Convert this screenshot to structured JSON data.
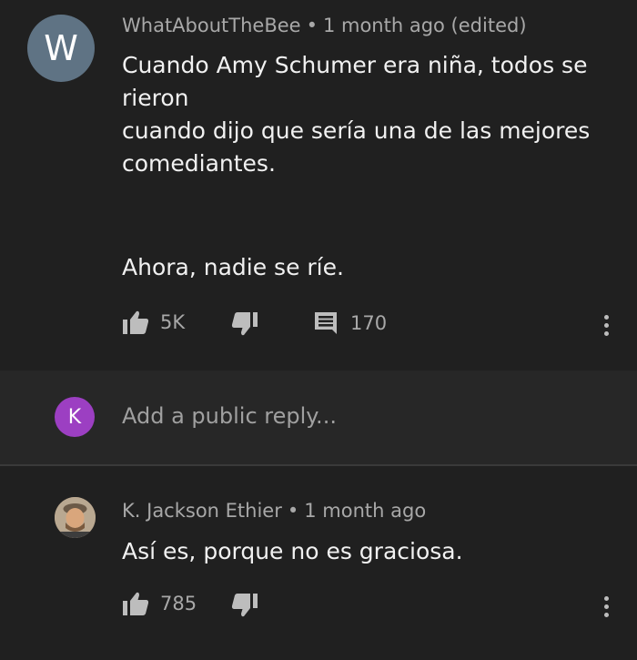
{
  "top_comment": {
    "avatar_letter": "W",
    "avatar_color": "#5f7384",
    "author": "WhatAboutTheBee",
    "time": "1 month ago (edited)",
    "text_line1": "Cuando Amy Schumer era niña, todos se rieron\ncuando dijo que sería una de las mejores\ncomediantes.",
    "text_line2": "Ahora, nadie se ríe.",
    "likes": "5K",
    "replies": "170"
  },
  "reply_box": {
    "avatar_letter": "K",
    "avatar_color": "#9c3fc2",
    "placeholder": "Add a public reply..."
  },
  "reply": {
    "avatar_icon": "user-photo",
    "author": "K. Jackson Ethier",
    "time": "1 month ago",
    "text": "Así es, porque no es graciosa.",
    "likes": "785"
  },
  "icons": {
    "like": "thumbs-up-icon",
    "dislike": "thumbs-down-icon",
    "comments": "comment-icon",
    "menu": "more-vert-icon"
  }
}
